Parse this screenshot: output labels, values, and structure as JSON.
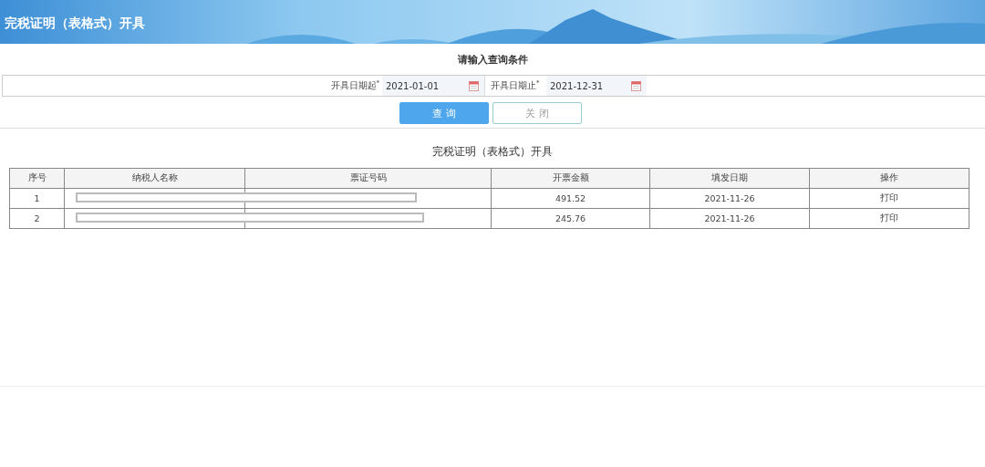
{
  "header": {
    "title": "完税证明（表格式）开具"
  },
  "query": {
    "title": "请输入查询条件",
    "fields": [
      {
        "label": "开具日期起$^{*}$",
        "value": "2021-01-01"
      },
      {
        "label": "开具日期止$^{*}$",
        "value": "2021-12-31"
      }
    ],
    "buttons": [
      {
        "label": "查 询",
        "kind": "primary"
      },
      {
        "label": "关 闭",
        "kind": "secondary"
      }
    ]
  },
  "table": {
    "title": "完税证明（表格式）开具",
    "columns": [
      "序号",
      "纳税人名称",
      "票证号码",
      "开票金额",
      "填发日期",
      "操作"
    ],
    "rows": [
      {
        "index": "1",
        "redacted": true,
        "amount": "491.52",
        "date": "2021-11-26",
        "action": "打印"
      },
      {
        "index": "2",
        "redacted": true,
        "amount": "245.76",
        "date": "2021-11-26",
        "action": "打印"
      }
    ]
  }
}
